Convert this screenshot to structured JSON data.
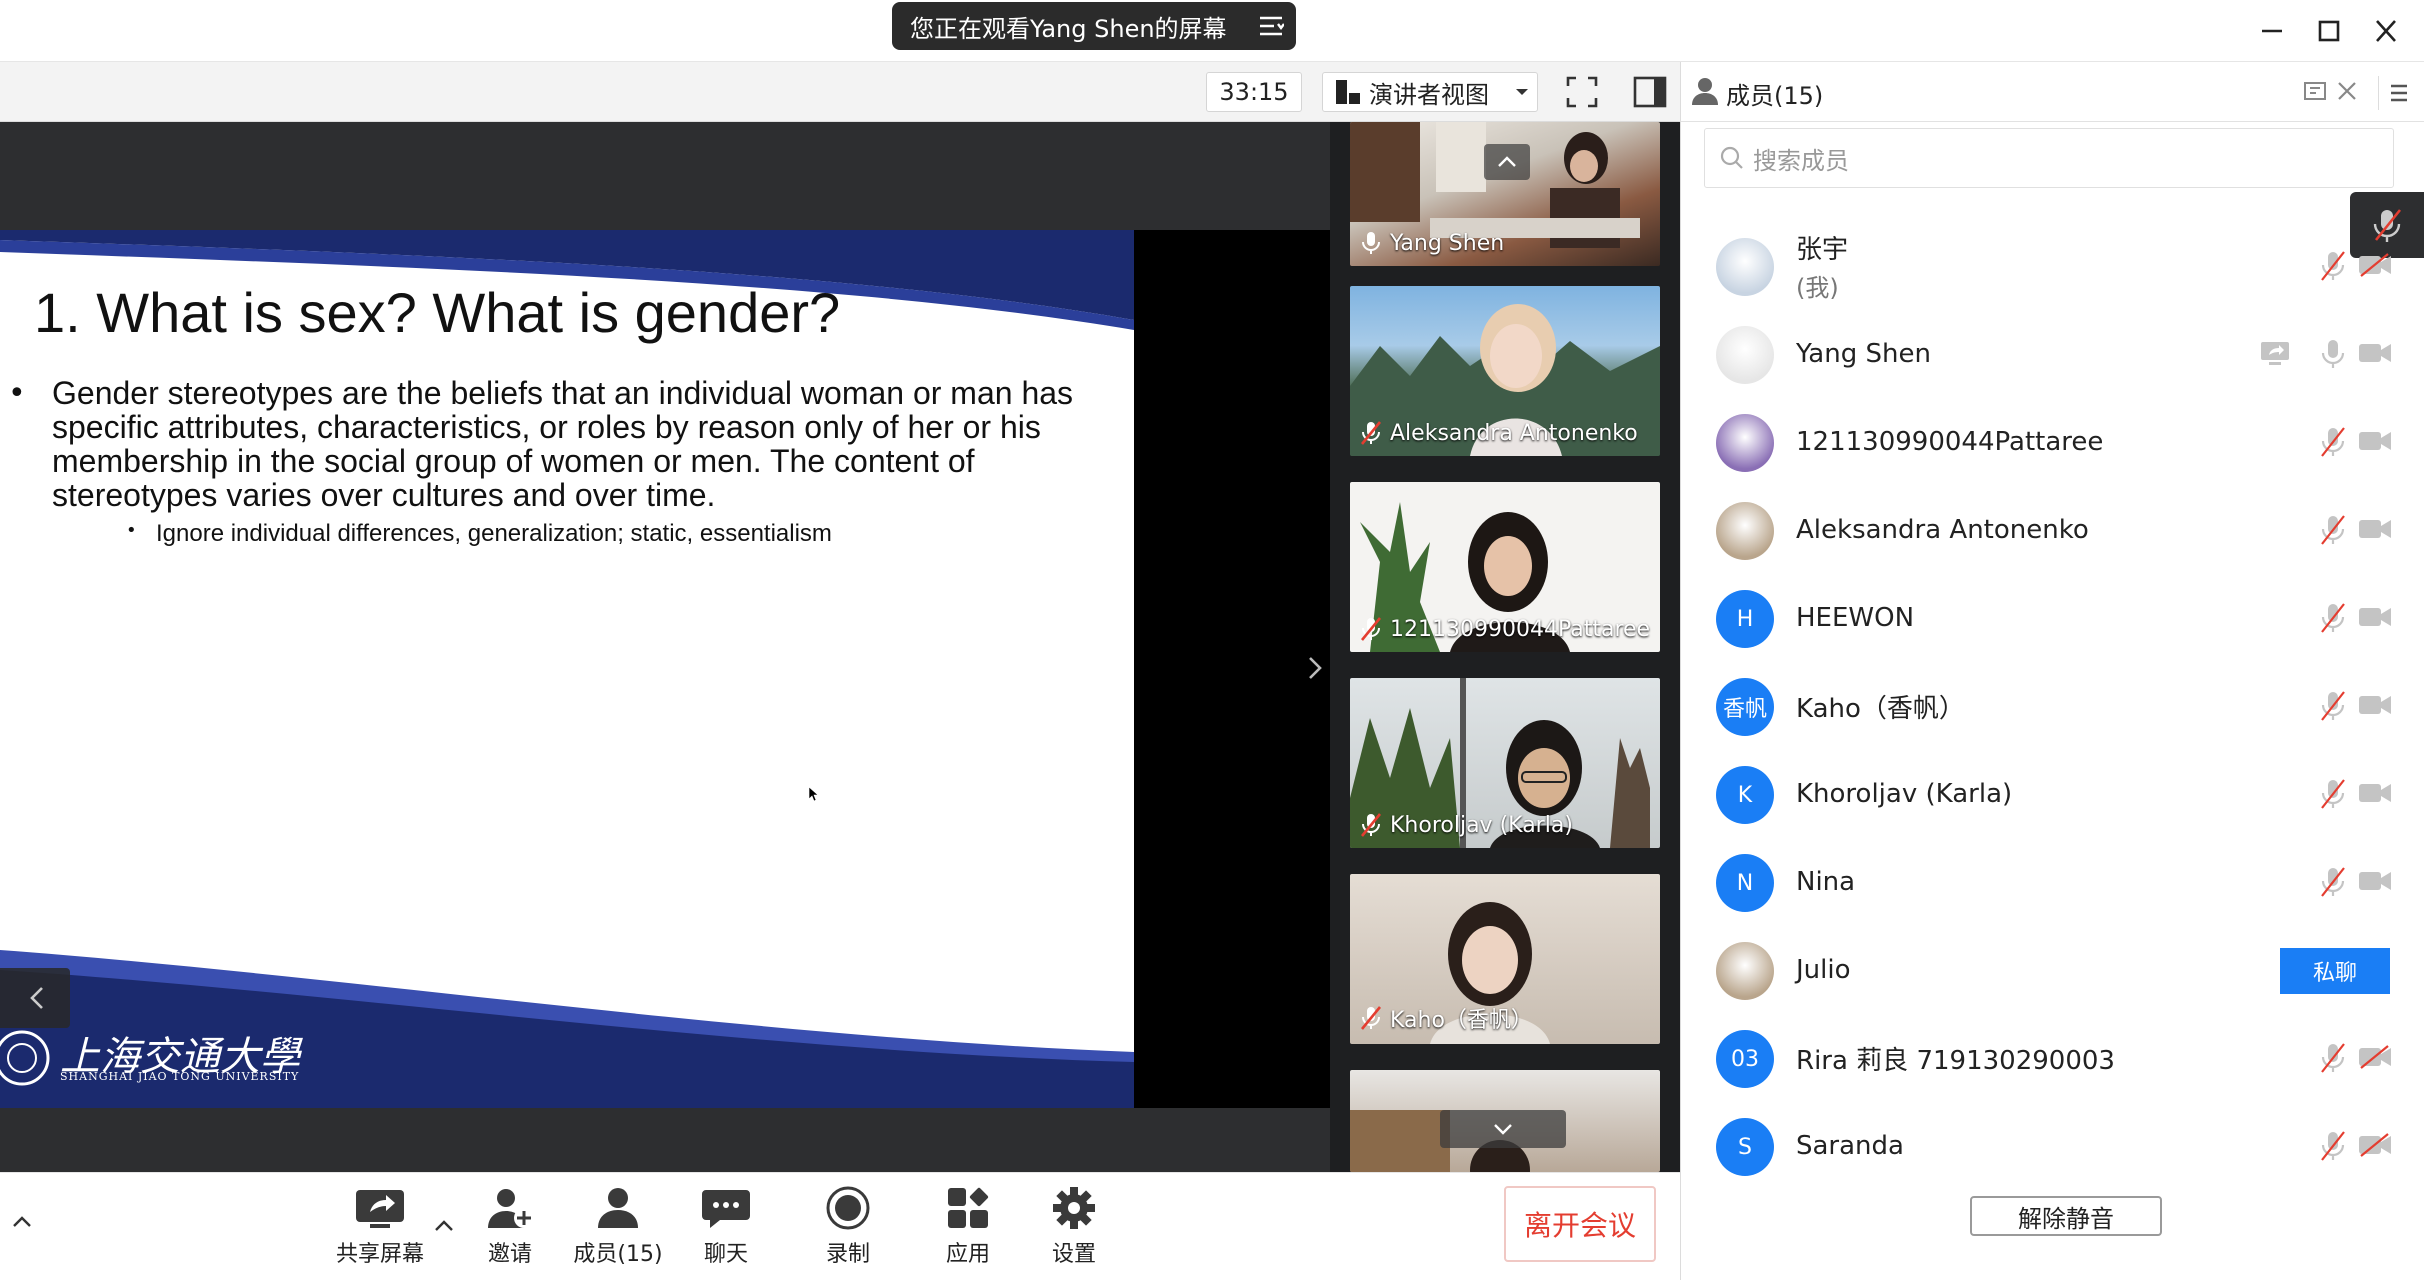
{
  "title_bar": {
    "share_banner_text": "您正在观看Yang Shen的屏幕"
  },
  "toolbar_top": {
    "timer": "33:15",
    "view_mode": "演讲者视图"
  },
  "members_panel": {
    "title": "成员(15)",
    "search_placeholder": "搜索成员",
    "members": [
      {
        "name": "张宇",
        "sub": "(我)",
        "avatar": "photo",
        "mic": "muted",
        "cam": "off"
      },
      {
        "name": "Yang Shen",
        "avatar": "photo",
        "mic": "on",
        "cam": "on",
        "sharing": true
      },
      {
        "name": "121130990044Pattaree",
        "avatar": "photo",
        "mic": "muted",
        "cam": "on"
      },
      {
        "name": "Aleksandra Antonenko",
        "avatar": "photo",
        "mic": "muted",
        "cam": "on"
      },
      {
        "name": "HEEWON",
        "avatar_text": "H",
        "mic": "muted",
        "cam": "on"
      },
      {
        "name": "Kaho（香帆）",
        "avatar_text": "香帆",
        "mic": "muted",
        "cam": "on"
      },
      {
        "name": "Khoroljav (Karla)",
        "avatar_text": "K",
        "mic": "muted",
        "cam": "on"
      },
      {
        "name": "Nina",
        "avatar_text": "N",
        "mic": "muted",
        "cam": "on"
      },
      {
        "name": "Julio",
        "avatar": "photo",
        "hover_button": "私聊"
      },
      {
        "name": "Rira 莉良 719130290003",
        "avatar_text": "03",
        "mic": "muted",
        "cam": "off"
      },
      {
        "name": "Saranda",
        "avatar_text": "S",
        "mic": "muted",
        "cam": "off"
      }
    ],
    "unmute_all": "解除静音"
  },
  "slide": {
    "title": "1. What is sex? What is gender?",
    "bullet1": "Gender stereotypes are the beliefs that an individual woman or man has specific attributes, characteristics, or roles by reason only of her or his membership in the social group of women or men. The content of stereotypes varies over cultures and over time.",
    "bullet2": "Ignore individual differences, generalization; static, essentialism",
    "university_cn": "上海交通大學",
    "university_en": "SHANGHAI JIAO TONG UNIVERSITY"
  },
  "gallery": [
    {
      "name": "Yang Shen",
      "mic": "on"
    },
    {
      "name": "Aleksandra Antonenko",
      "mic": "muted"
    },
    {
      "name": "121130990044Pattaree",
      "mic": "muted"
    },
    {
      "name": "Khoroljav (Karla)",
      "mic": "muted"
    },
    {
      "name": "Kaho（香帆）",
      "mic": "muted"
    }
  ],
  "bottom_toolbar": {
    "share_screen": "共享屏幕",
    "invite": "邀请",
    "members": "成员(15)",
    "chat": "聊天",
    "record": "录制",
    "apps": "应用",
    "settings": "设置",
    "leave": "离开会议"
  },
  "colors": {
    "accent": "#1a7ef5",
    "leave_red": "#e43d30",
    "slide_navy": "#1b2a6e",
    "dark_bg": "#2d2e30"
  }
}
